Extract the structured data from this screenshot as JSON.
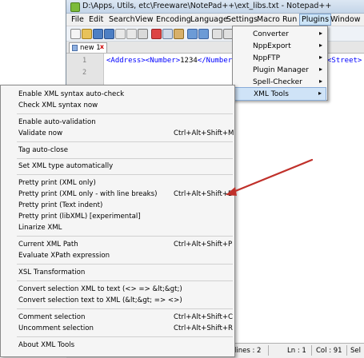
{
  "window": {
    "title": "D:\\Apps, Utils, etc\\Freeware\\NotePad++\\ext_libs.txt - Notepad++"
  },
  "menubar": {
    "items": [
      "File",
      "Edit",
      "Search",
      "View",
      "Encoding",
      "Language",
      "Settings",
      "Macro",
      "Run",
      "Plugins",
      "Window"
    ],
    "active": "Plugins"
  },
  "tab": {
    "label": "new 1",
    "close": "x"
  },
  "editor": {
    "lines": [
      "1",
      "2"
    ],
    "code": {
      "t1": "<Address>",
      "t2": "<Number>",
      "value": "1234",
      "t3": "</Number>",
      "t4": "<Street>",
      "t5": "</"
    }
  },
  "plugins_menu": {
    "items": [
      {
        "label": "Converter",
        "submenu": true
      },
      {
        "label": "NppExport",
        "submenu": true
      },
      {
        "label": "NppFTP",
        "submenu": true
      },
      {
        "label": "Plugin Manager",
        "submenu": true
      },
      {
        "label": "Spell-Checker",
        "submenu": true
      },
      {
        "label": "XML Tools",
        "submenu": true
      }
    ],
    "arrow": "▸",
    "active_label": "XML Tools"
  },
  "xml_tools_menu": {
    "items": [
      {
        "label": "Enable XML syntax auto-check",
        "shortcut": ""
      },
      {
        "label": "Check XML syntax now",
        "shortcut": ""
      },
      {
        "label": "Enable auto-validation",
        "shortcut": ""
      },
      {
        "label": "Validate now",
        "shortcut": "Ctrl+Alt+Shift+M"
      },
      {
        "label": "Tag auto-close",
        "shortcut": ""
      },
      {
        "label": "Set XML type automatically",
        "shortcut": ""
      },
      {
        "label": "Pretty print (XML only)",
        "shortcut": ""
      },
      {
        "label": "Pretty print (XML only - with line breaks)",
        "shortcut": "Ctrl+Alt+Shift+B"
      },
      {
        "label": "Pretty print (Text indent)",
        "shortcut": ""
      },
      {
        "label": "Pretty print (libXML) [experimental]",
        "shortcut": ""
      },
      {
        "label": "Linarize XML",
        "shortcut": ""
      },
      {
        "label": "Current XML Path",
        "shortcut": "Ctrl+Alt+Shift+P"
      },
      {
        "label": "Evaluate XPath expression",
        "shortcut": ""
      },
      {
        "label": "XSL Transformation",
        "shortcut": ""
      },
      {
        "label": "Convert selection XML to text (<> => &lt;&gt;)",
        "shortcut": ""
      },
      {
        "label": "Convert selection text to XML (&lt;&gt; => <>)",
        "shortcut": ""
      },
      {
        "label": "Comment selection",
        "shortcut": "Ctrl+Alt+Shift+C"
      },
      {
        "label": "Uncomment selection",
        "shortcut": "Ctrl+Alt+Shift+R"
      },
      {
        "label": "About XML Tools",
        "shortcut": ""
      }
    ]
  },
  "statusbar": {
    "lines": "lines : 2",
    "ln": "Ln : 1",
    "col": "Col : 91",
    "sel": "Sel"
  },
  "colors": {
    "annotation_arrow": "#c0302a",
    "xml_tag": "#0000ff",
    "menu_highlight": "#cfe3f7"
  }
}
